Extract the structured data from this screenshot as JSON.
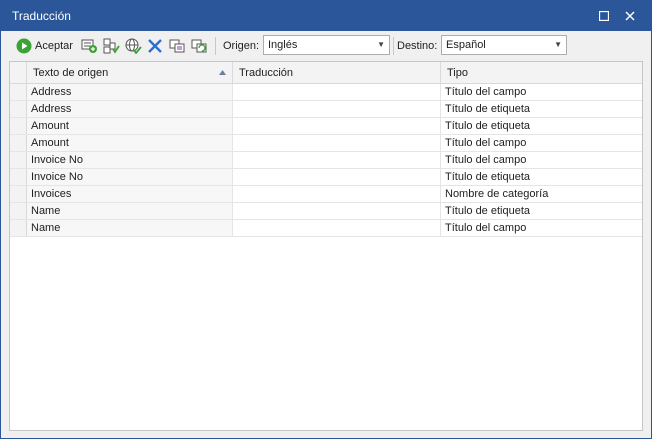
{
  "window": {
    "title": "Traducción"
  },
  "toolbar": {
    "accept_label": "Aceptar",
    "source_label": "Origen:",
    "source_value": "Inglés",
    "target_label": "Destino:",
    "target_value": "Español"
  },
  "grid": {
    "columns": [
      "Texto de origen",
      "Traducción",
      "Tipo"
    ],
    "rows": [
      {
        "source": "Address",
        "translation": "",
        "type": "Título del campo"
      },
      {
        "source": "Address",
        "translation": "",
        "type": "Título de etiqueta"
      },
      {
        "source": "Amount",
        "translation": "",
        "type": "Título de etiqueta"
      },
      {
        "source": "Amount",
        "translation": "",
        "type": "Título del campo"
      },
      {
        "source": "Invoice No",
        "translation": "",
        "type": "Título del campo"
      },
      {
        "source": "Invoice No",
        "translation": "",
        "type": "Título de etiqueta"
      },
      {
        "source": "Invoices",
        "translation": "",
        "type": "Nombre de categoría"
      },
      {
        "source": "Name",
        "translation": "",
        "type": "Título de etiqueta"
      },
      {
        "source": "Name",
        "translation": "",
        "type": "Título del campo"
      }
    ]
  },
  "colors": {
    "titlebar": "#2b579a",
    "accept_icon": "#3aa335",
    "delete_icon": "#2c6fd1"
  }
}
